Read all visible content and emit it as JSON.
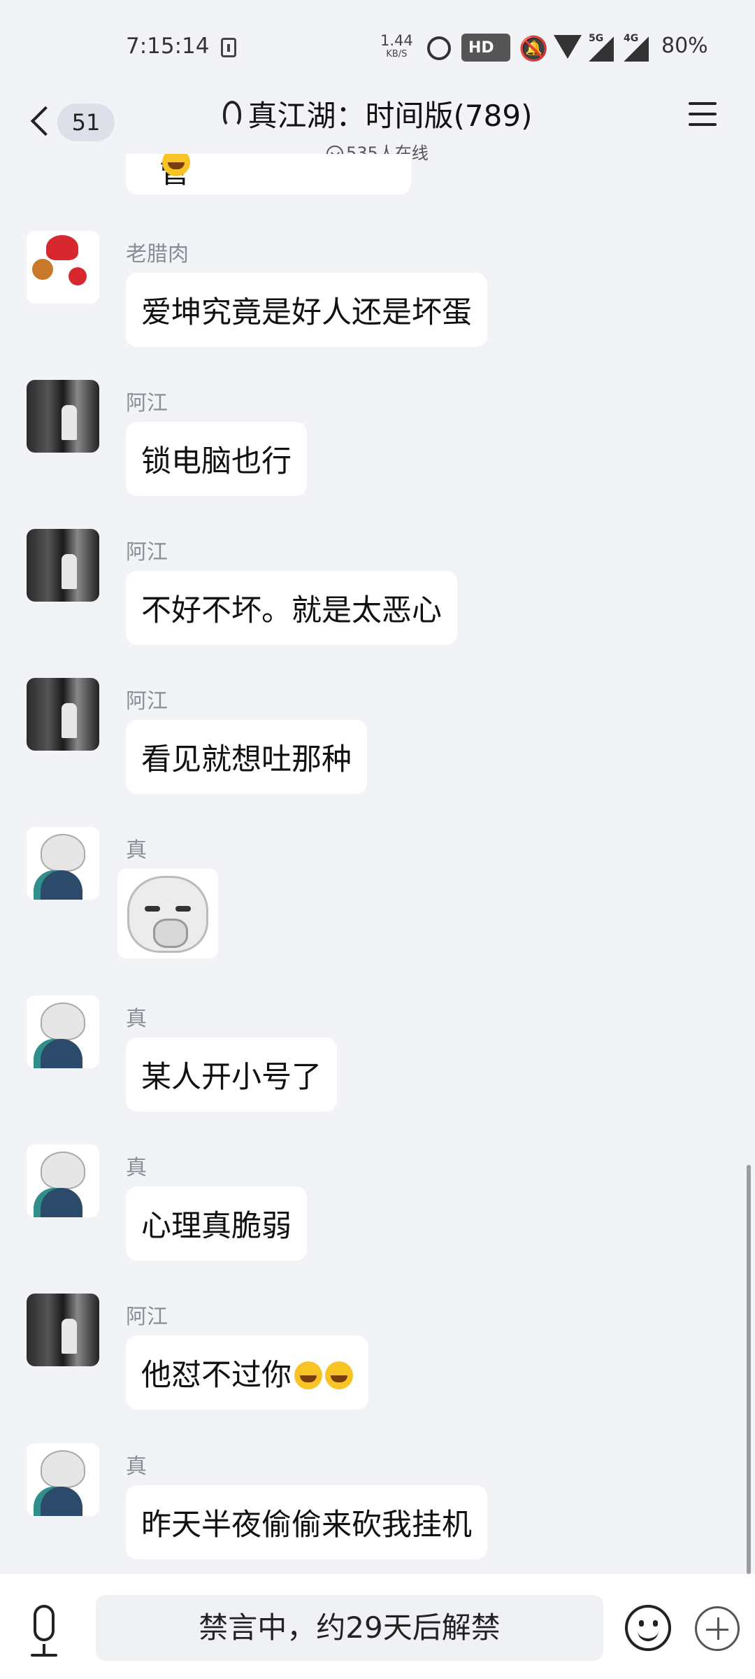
{
  "status_bar": {
    "time": "7:15:14",
    "net_speed": "1.44",
    "net_speed_unit": "KB/S",
    "hd_label": "HD",
    "net_5g": "5G",
    "net_4g": "4G",
    "battery": "80%"
  },
  "header": {
    "back_count": "51",
    "title": "真江湖：时间版(789)",
    "online": "535人在线"
  },
  "messages": [
    {
      "sender": "",
      "text": "管理不能封ip么"
    },
    {
      "sender": "老腊肉",
      "text": "爱坤究竟是好人还是坏蛋"
    },
    {
      "sender": "阿江",
      "text": "锁电脑也行"
    },
    {
      "sender": "阿江",
      "text": "不好不坏。就是太恶心"
    },
    {
      "sender": "阿江",
      "text": "看见就想吐那种"
    },
    {
      "sender": "真",
      "text": ""
    },
    {
      "sender": "真",
      "text": "某人开小号了"
    },
    {
      "sender": "真",
      "text": "心理真脆弱"
    },
    {
      "sender": "阿江",
      "text": "他怼不过你"
    },
    {
      "sender": "真",
      "text": "昨天半夜偷偷来砍我挂机"
    }
  ],
  "input": {
    "muted_text": "禁言中，约29天后解禁"
  }
}
